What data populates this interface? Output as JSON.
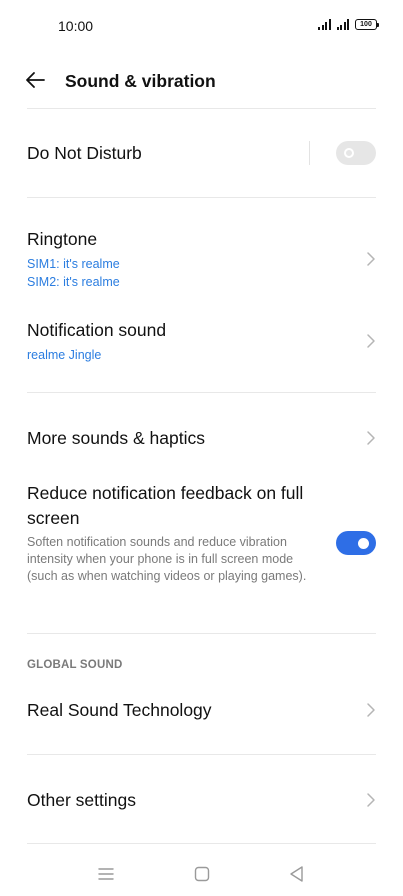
{
  "status_bar": {
    "time": "10:00",
    "battery": "100"
  },
  "header": {
    "title": "Sound & vibration",
    "back_icon": "arrow-left-icon"
  },
  "do_not_disturb": {
    "label": "Do Not Disturb",
    "enabled": false
  },
  "ringtone": {
    "label": "Ringtone",
    "sim1": "SIM1: it's realme",
    "sim2": "SIM2: it's realme"
  },
  "notification_sound": {
    "label": "Notification sound",
    "value": "realme Jingle"
  },
  "more_sounds": {
    "label": "More sounds & haptics"
  },
  "reduce_feedback": {
    "label_line1": "Reduce notification feedback on full",
    "label_line2": "screen",
    "description": "Soften notification sounds and reduce vibration intensity when your phone is in full screen mode (such as when watching videos or playing games).",
    "enabled": true
  },
  "global_sound": {
    "section_label": "GLOBAL SOUND",
    "real_sound": "Real Sound Technology"
  },
  "other_settings": {
    "label": "Other settings"
  },
  "nav_bar": {
    "icons": [
      "menu-icon",
      "home-square-icon",
      "back-triangle-icon"
    ]
  },
  "colors": {
    "accent": "#2e6ee6",
    "link": "#2b7de0",
    "secondary_text": "#7a7a7a",
    "divider": "#e8e8e8"
  }
}
